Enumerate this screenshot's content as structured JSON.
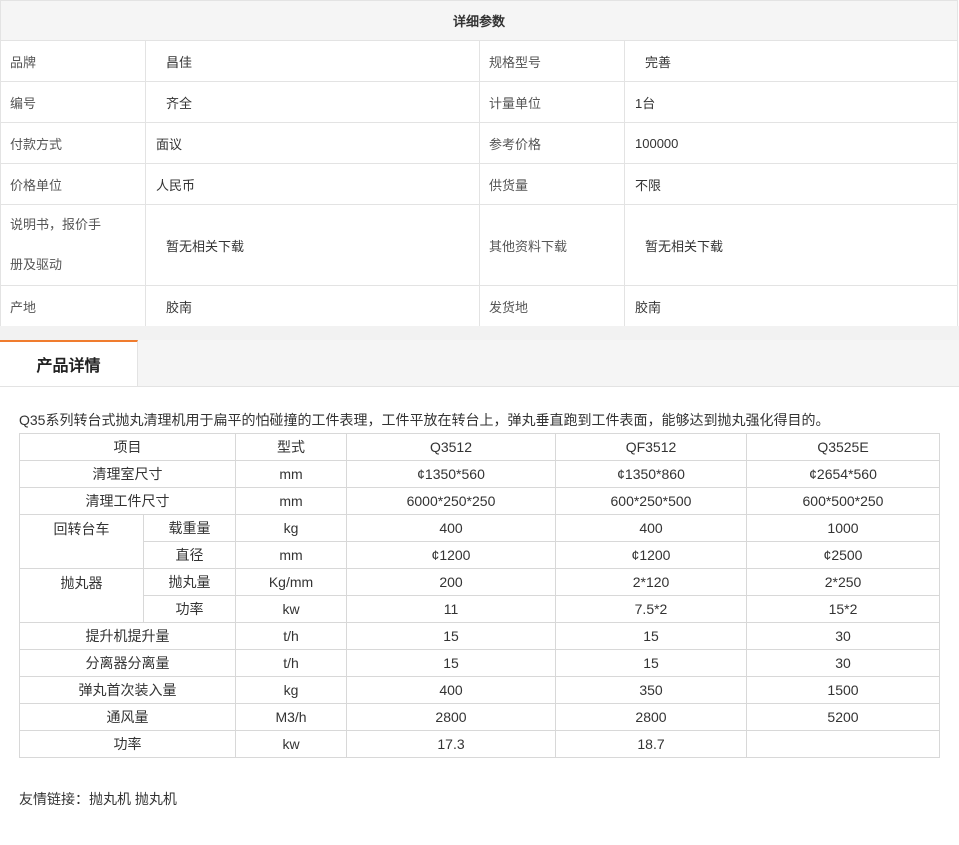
{
  "params": {
    "title": "详细参数",
    "rows": [
      {
        "k1": "品牌",
        "v1": "昌佳",
        "k2": "规格型号",
        "v2": "完善"
      },
      {
        "k1": "编号",
        "v1": "齐全",
        "k2": "计量单位",
        "v2": "1台"
      },
      {
        "k1": "付款方式",
        "v1": "面议",
        "k2": "参考价格",
        "v2": "100000"
      },
      {
        "k1": "价格单位",
        "v1": "人民币",
        "k2": "供货量",
        "v2": "不限"
      },
      {
        "k1_line1": "说明书，报价手",
        "k1_line2": "册及驱动",
        "v1": "暂无相关下载",
        "k2": "其他资料下载",
        "v2": "暂无相关下载"
      },
      {
        "k1": "产地",
        "v1": "胶南",
        "k2": "发货地",
        "v2": "胶南"
      }
    ]
  },
  "tabs": {
    "active": "产品详情"
  },
  "description": "Q35系列转台式抛丸清理机用于扁平的怕碰撞的工件表理，工件平放在转台上，弹丸垂直跑到工件表面，能够达到抛丸强化得目的。",
  "spec": {
    "header": [
      "项目",
      "型式",
      "Q3512",
      "QF3512",
      "Q3525E"
    ],
    "room": {
      "label": "清理室尺寸",
      "unit": "mm",
      "values": [
        "¢1350*560",
        "¢1350*860",
        "¢2654*560"
      ]
    },
    "workpiece": {
      "label": "清理工件尺寸",
      "unit": "mm",
      "values": [
        "6000*250*250",
        "600*250*500",
        "600*500*250"
      ]
    },
    "turntable": {
      "group": "回转台车",
      "load": {
        "label": "载重量",
        "unit": "kg",
        "values": [
          "400",
          "400",
          "1000"
        ]
      },
      "diameter": {
        "label": "直径",
        "unit": "mm",
        "values": [
          "¢1200",
          "¢1200",
          "¢2500"
        ]
      }
    },
    "blaster": {
      "group": "抛丸器",
      "amount": {
        "label": "抛丸量",
        "unit": "Kg/mm",
        "values": [
          "200",
          "2*120",
          "2*250"
        ]
      },
      "power": {
        "label": "功率",
        "unit": "kw",
        "values": [
          "11",
          "7.5*2",
          "15*2"
        ]
      }
    },
    "elevator": {
      "label": "提升机提升量",
      "unit": "t/h",
      "values": [
        "15",
        "15",
        "30"
      ]
    },
    "separator": {
      "label": "分离器分离量",
      "unit": "t/h",
      "values": [
        "15",
        "15",
        "30"
      ]
    },
    "shot": {
      "label": "弹丸首次装入量",
      "unit": "kg",
      "values": [
        "400",
        "350",
        "1500"
      ]
    },
    "air": {
      "label": "通风量",
      "unit": "M3/h",
      "values": [
        "2800",
        "2800",
        "5200"
      ]
    },
    "total_power": {
      "label": "功率",
      "unit": "kw",
      "values": [
        "17.3",
        "18.7",
        ""
      ]
    }
  },
  "friend_links": {
    "label": "友情链接：",
    "links": [
      "抛丸机",
      "抛丸机"
    ]
  }
}
